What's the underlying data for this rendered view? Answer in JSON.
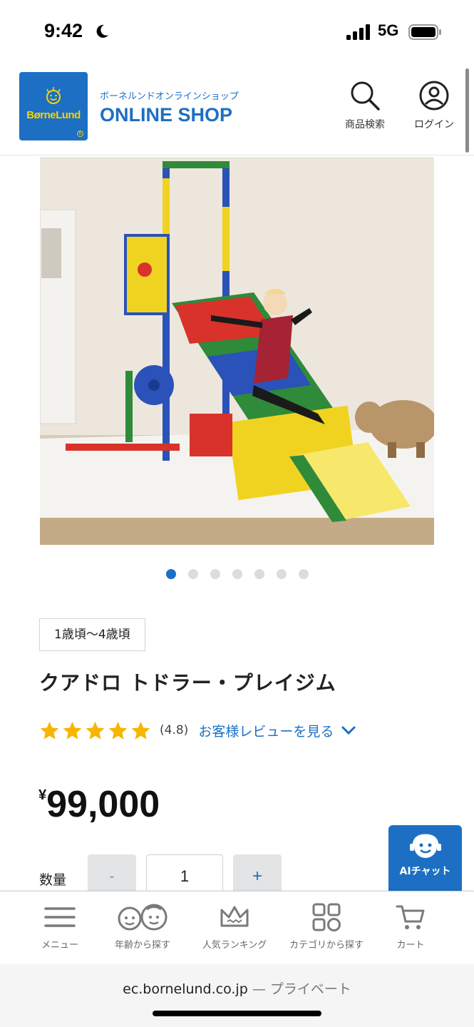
{
  "status_bar": {
    "time": "9:42",
    "network": "5G",
    "icons": [
      "moon-icon",
      "signal-icon",
      "battery-icon"
    ]
  },
  "header": {
    "logo_text": "BørneLund",
    "brand_sub": "ボーネルンドオンラインショップ",
    "brand_main": "ONLINE SHOP",
    "search_label": "商品検索",
    "login_label": "ログイン",
    "accent_color": "#1d6fc4"
  },
  "carousel": {
    "total": 7,
    "active_index": 0
  },
  "product": {
    "age_badge": "1歳頃〜4歳頃",
    "title": "クアドロ トドラー・プレイジム",
    "rating_stars": 5,
    "rating_value": "(4.8)",
    "review_link": "お客様レビューを見る",
    "price_currency": "¥",
    "price_amount": "99,000",
    "star_color": "#f7b500"
  },
  "quantity": {
    "label": "数量",
    "minus": "-",
    "value": "1",
    "plus": "+"
  },
  "ai_chat": {
    "label": "AIチャット"
  },
  "bottom_nav": {
    "items": [
      {
        "label": "メニュー",
        "icon": "hamburger-menu-icon"
      },
      {
        "label": "年齢から探す",
        "icon": "kids-faces-icon"
      },
      {
        "label": "人気ランキング",
        "icon": "crown-icon"
      },
      {
        "label": "カテゴリから探す",
        "icon": "grid-icon"
      },
      {
        "label": "カート",
        "icon": "cart-icon"
      }
    ]
  },
  "browser": {
    "domain": "ec.bornelund.co.jp",
    "private_label": "— プライベート"
  }
}
